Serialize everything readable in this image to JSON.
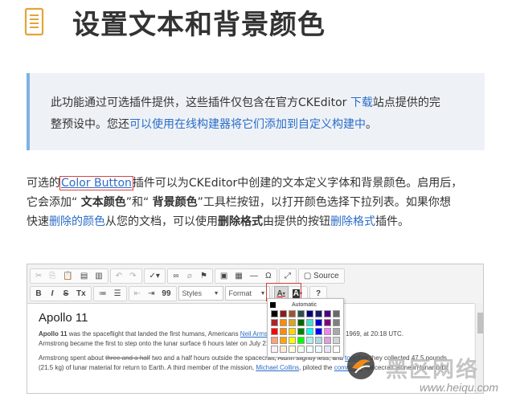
{
  "page": {
    "title": "设置文本和背景颜色"
  },
  "callout": {
    "line1_text": "此功能通过可选插件提供，这些插件仅包含在官方CKEditor ",
    "line1_link": "下载",
    "line1_tail": "站点提供的完",
    "line2_text": "整预设中。您还",
    "line2_link": "可以使用在线构建器将它们添加到自定义构建中",
    "line2_tail": "。"
  },
  "body": {
    "p1_a": "可选的",
    "p1_link": "Color Button",
    "p1_b": "插件可以为CKEditor中创建的文本定义字体和背景颜色。启用后，",
    "p2_a": "它会添加“ ",
    "p2_b1": "文本颜色",
    "p2_c": "”和“ ",
    "p2_b2": "背景颜色",
    "p2_d": "”工具栏按钮，以打开颜色选择下拉列表。如果你想",
    "p3_a": "快速",
    "p3_link1": "删除的颜色",
    "p3_b": "从您的文档，可以使用",
    "p3_bold": "删除格式",
    "p3_c": "由提供的按钮",
    "p3_link2": "删除格式",
    "p3_d": "插件。"
  },
  "editor": {
    "toolbar": {
      "source_label": "Source",
      "styles_label": "Styles",
      "format_label": "Format",
      "bold": "B",
      "italic": "I",
      "strike": "S",
      "remove_format": "Tx",
      "blockquote": "99",
      "help": "?",
      "text_color": "A",
      "bg_color": "A"
    },
    "picker": {
      "automatic_label": "Automatic",
      "colors": [
        "#000000",
        "#8b1a1a",
        "#a0522d",
        "#2f4f4f",
        "#000080",
        "#191970",
        "#4b0082",
        "#696969",
        "#b22222",
        "#ff8c00",
        "#daa520",
        "#006400",
        "#40e0d0",
        "#0000cd",
        "#800080",
        "#808080",
        "#ff0000",
        "#ff8c00",
        "#ffd700",
        "#008000",
        "#00ffff",
        "#0000ff",
        "#ee82ee",
        "#a9a9a9",
        "#ffa07a",
        "#ffa500",
        "#ffff00",
        "#00ff00",
        "#afeeee",
        "#add8e6",
        "#dda0dd",
        "#d3d3d3",
        "#fff0f5",
        "#faebd7",
        "#ffffe0",
        "#f0fff0",
        "#f0ffff",
        "#f0f8ff",
        "#e6e6fa",
        "#ffffff"
      ]
    },
    "content": {
      "heading": "Apollo 11",
      "p1_bold": "Apollo 11",
      "p1_text": " was the spaceflight that landed the first humans, Americans ",
      "p1_link": "Neil Armstrong",
      "p1_tail": "  the Moon on July 20, 1969, at 20:18 UTC.",
      "p1_line2": "Armstrong became the first to step onto the lunar surface 6 hours later on July 21",
      "p2_a": "Armstrong spent about ",
      "p2_strike": "three and a half",
      "p2_b": " two and a half hours outside the spacecraft, Aldrin slightly less, and ",
      "p2_link": "together",
      "p2_c": " they collected 47.5 pounds",
      "p2_line2": "(21.5 kg) of lunar material for return to Earth. A third member of the mission, ",
      "p2_link2": "Michael Collins",
      "p2_d": ", piloted the ",
      "p2_link3": "command",
      "p2_e": " spacecraft alone in lunar orbit"
    }
  },
  "watermark": {
    "main": "黑区网络",
    "sub": "www.heiqu.com"
  },
  "colors": {
    "link": "#2b6dc7",
    "callout_bg": "#eef2f7",
    "callout_border": "#7fb2e2",
    "icon": "#e3a43a",
    "highlight_box": "#d83a3a"
  }
}
